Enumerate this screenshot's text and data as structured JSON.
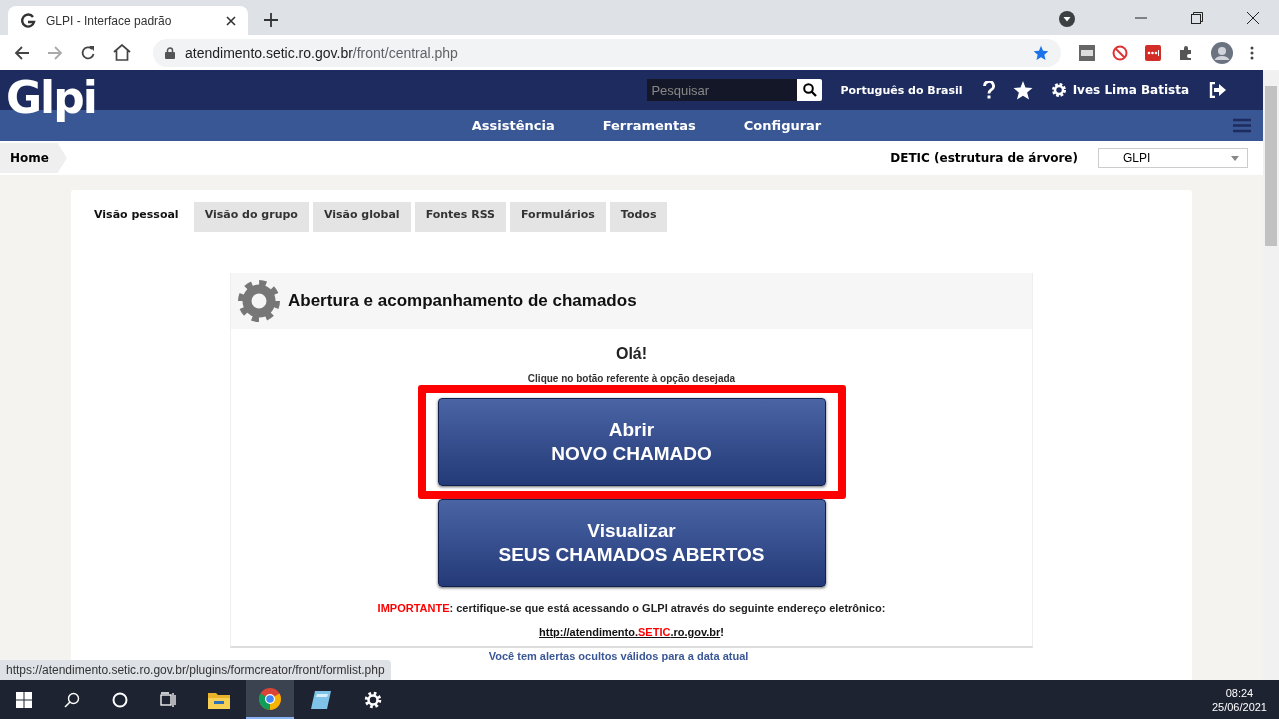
{
  "browser": {
    "tab_title": "GLPI - Interface padrão",
    "url_host": "atendimento.setic.ro.gov.br",
    "url_path": "/front/central.php",
    "status_url": "https://atendimento.setic.ro.gov.br/plugins/formcreator/front/formlist.php"
  },
  "header": {
    "logo": "Glpi",
    "search_placeholder": "Pesquisar",
    "language": "Português do Brasil",
    "user": "Ives Lima Batista"
  },
  "menu": [
    "Assistência",
    "Ferramentas",
    "Configurar"
  ],
  "breadcrumb": "Home",
  "entity": {
    "label": "DETIC (estrutura de árvore)",
    "value": "GLPI"
  },
  "tabs": [
    {
      "label": "Visão pessoal",
      "selected": true
    },
    {
      "label": "Visão do grupo",
      "selected": false
    },
    {
      "label": "Visão global",
      "selected": false
    },
    {
      "label": "Fontes RSS",
      "selected": false
    },
    {
      "label": "Formulários",
      "selected": false
    },
    {
      "label": "Todos",
      "selected": false
    }
  ],
  "panel": {
    "title": "Abertura e acompanhamento de chamados",
    "greeting": "Olá!",
    "instruction": "Clique no botão referente à opção desejada",
    "buttons": [
      {
        "line1": "Abrir",
        "line2": "NOVO CHAMADO",
        "highlighted": true
      },
      {
        "line1": "Visualizar",
        "line2": "SEUS CHAMADOS ABERTOS",
        "highlighted": false
      }
    ],
    "notice_label": "IMPORTANTE",
    "notice_text": ": certifique-se que está acessando o GLPI através do seguinte endereço eletrônico:",
    "link_parts": [
      {
        "text": "http://atendimento.",
        "kind": "plain"
      },
      {
        "text": "SETIC",
        "kind": "accent"
      },
      {
        "text": ".ro.gov.br",
        "kind": "plain"
      }
    ],
    "link_end": "!"
  },
  "alerts": "Você tem alertas ocultos válidos para a data atual",
  "taskbar": {
    "time": "08:24",
    "date": "25/06/2021"
  }
}
